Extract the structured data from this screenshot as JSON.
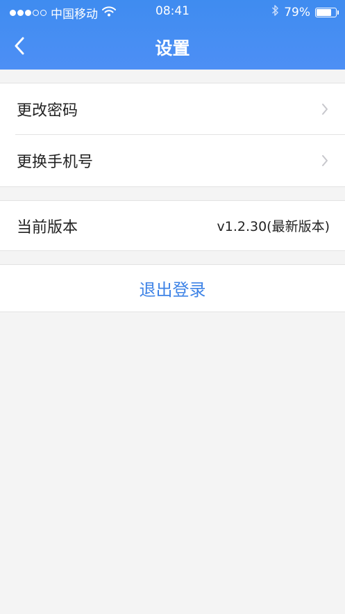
{
  "status_bar": {
    "carrier": "中国移动",
    "time": "08:41",
    "battery_percent": "79%",
    "battery_level": 0.79,
    "signal_bars": 3,
    "signal_total": 5,
    "icons": [
      "signal-dots-icon",
      "wifi-icon",
      "bluetooth-icon",
      "battery-icon"
    ]
  },
  "nav": {
    "title": "设置",
    "back_icon": "chevron-left-icon"
  },
  "groups": {
    "account": {
      "items": [
        {
          "label": "更改密码",
          "icon": "chevron-right-icon"
        },
        {
          "label": "更换手机号",
          "icon": "chevron-right-icon"
        }
      ]
    },
    "version": {
      "label": "当前版本",
      "value": "v1.2.30(最新版本)"
    },
    "logout": {
      "label": "退出登录"
    }
  },
  "colors": {
    "header": "#4a8ff3",
    "background": "#f4f4f4",
    "accent": "#3e83e6",
    "chevron": "#c7c7cc"
  }
}
